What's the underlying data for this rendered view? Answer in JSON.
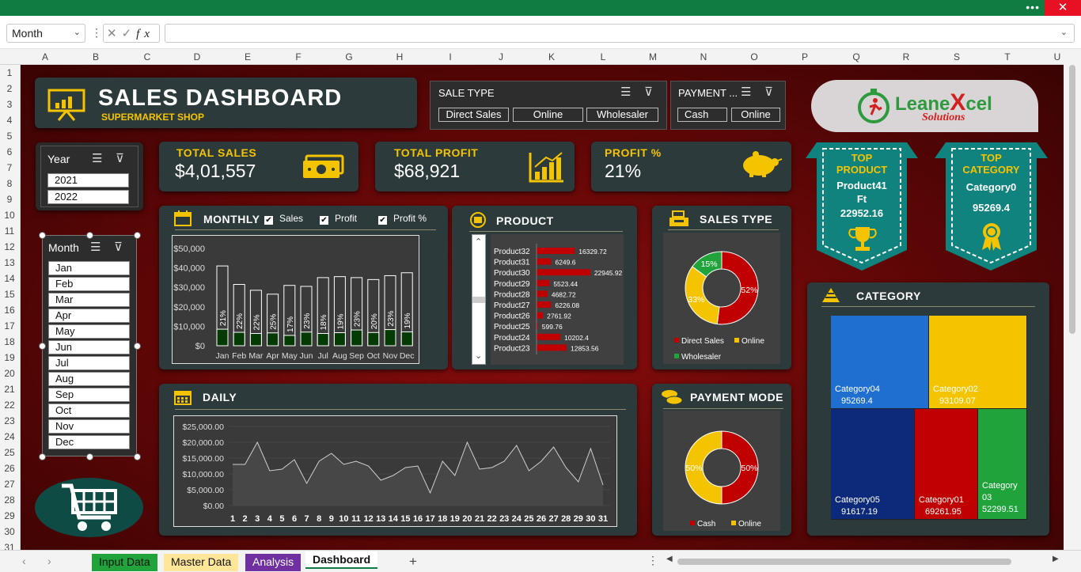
{
  "excel": {
    "name_box": "Month",
    "fx_label": "fx",
    "columns": [
      "A",
      "B",
      "C",
      "D",
      "E",
      "F",
      "G",
      "H",
      "I",
      "J",
      "K",
      "L",
      "M",
      "N",
      "O",
      "P",
      "Q",
      "R",
      "S",
      "T",
      "U"
    ],
    "rows": [
      "1",
      "2",
      "3",
      "4",
      "5",
      "6",
      "7",
      "8",
      "9",
      "10",
      "11",
      "12",
      "13",
      "14",
      "15",
      "16",
      "17",
      "18",
      "19",
      "20",
      "21",
      "22",
      "23",
      "24",
      "25",
      "26",
      "27",
      "28",
      "29",
      "30",
      "31"
    ],
    "sheet_tabs": [
      {
        "label": "Input Data",
        "color": "#21a33c"
      },
      {
        "label": "Master Data",
        "color": "#ffe699"
      },
      {
        "label": "Analysis",
        "color": "#7030a0"
      },
      {
        "label": "Dashboard",
        "color": "#ffffff"
      }
    ],
    "add_sheet": "+"
  },
  "header": {
    "title": "SALES DASHBOARD",
    "subtitle": "SUPERMARKET SHOP"
  },
  "logo": {
    "brand_a": "Leane",
    "brand_x": "X",
    "brand_b": "cel",
    "tagline": "Solutions"
  },
  "slicers": {
    "sale_type": {
      "title": "SALE TYPE",
      "items": [
        "Direct Sales",
        "Online",
        "Wholesaler"
      ]
    },
    "payment": {
      "title": "PAYMENT ...",
      "items": [
        "Cash",
        "Online"
      ]
    },
    "year": {
      "title": "Year",
      "items": [
        "2021",
        "2022"
      ]
    },
    "month": {
      "title": "Month",
      "items": [
        "Jan",
        "Feb",
        "Mar",
        "Apr",
        "May",
        "Jun",
        "Jul",
        "Aug",
        "Sep",
        "Oct",
        "Nov",
        "Dec"
      ]
    }
  },
  "kpis": {
    "total_sales": {
      "label": "TOTAL SALES",
      "value": "$4,01,557"
    },
    "total_profit": {
      "label": "TOTAL PROFIT",
      "value": "$68,921"
    },
    "profit_pct": {
      "label": "PROFIT %",
      "value": "21%"
    }
  },
  "top_product": {
    "title_a": "TOP",
    "title_b": "PRODUCT",
    "name_a": "Product41",
    "name_b": "Ft",
    "value": "22952.16"
  },
  "top_category": {
    "title_a": "TOP",
    "title_b": "CATEGORY",
    "name": "Category0",
    "value": "95269.4"
  },
  "monthly": {
    "title": "MONTHLY",
    "checks": [
      "Sales",
      "Profit",
      "Profit %"
    ]
  },
  "product_panel": {
    "title": "PRODUCT"
  },
  "sales_type_panel": {
    "title": "SALES TYPE"
  },
  "daily": {
    "title": "DAILY"
  },
  "payment_panel": {
    "title": "PAYMENT MODE"
  },
  "category_panel": {
    "title": "CATEGORY"
  },
  "chart_data": [
    {
      "type": "bar",
      "title": "MONTHLY",
      "categories": [
        "Jan",
        "Feb",
        "Mar",
        "Apr",
        "May",
        "Jun",
        "Jul",
        "Aug",
        "Sep",
        "Oct",
        "Nov",
        "Dec"
      ],
      "series": [
        {
          "name": "Sales",
          "values": [
            41000,
            31500,
            28500,
            26500,
            31000,
            30500,
            35000,
            35500,
            35000,
            34000,
            36000,
            37500
          ]
        },
        {
          "name": "Profit",
          "values": [
            8500,
            6900,
            6300,
            6600,
            5300,
            7000,
            6300,
            6700,
            8100,
            6800,
            8300,
            7100
          ]
        },
        {
          "name": "Profit %",
          "values": [
            "21%",
            "22%",
            "22%",
            "25%",
            "17%",
            "23%",
            "18%",
            "19%",
            "23%",
            "20%",
            "23%",
            "19%"
          ]
        }
      ],
      "ytick_labels": [
        "$50,000",
        "$40,000",
        "$30,000",
        "$20,000",
        "$10,000",
        "$0"
      ],
      "ylim": [
        0,
        50000
      ]
    },
    {
      "type": "bar",
      "title": "PRODUCT",
      "orientation": "horizontal",
      "categories": [
        "Product32",
        "Product31",
        "Product30",
        "Product29",
        "Product28",
        "Product27",
        "Product26",
        "Product25",
        "Product24",
        "Product23"
      ],
      "values": [
        16329.72,
        6249.6,
        22945.92,
        5523.44,
        4682.72,
        6226.08,
        2761.92,
        599.76,
        10202.4,
        12853.56
      ]
    },
    {
      "type": "pie",
      "title": "SALES TYPE",
      "labels": [
        "Direct Sales",
        "Online",
        "Wholesaler"
      ],
      "values": [
        52,
        33,
        15
      ],
      "value_labels": [
        "52%",
        "33%",
        "15%"
      ],
      "colors": [
        "#c00000",
        "#f5c400",
        "#21a33c"
      ]
    },
    {
      "type": "line",
      "title": "DAILY",
      "x": [
        1,
        2,
        3,
        4,
        5,
        6,
        7,
        8,
        9,
        10,
        11,
        12,
        13,
        14,
        15,
        16,
        17,
        18,
        19,
        20,
        21,
        22,
        23,
        24,
        25,
        26,
        27,
        28,
        29,
        30,
        31
      ],
      "y": [
        13000,
        13000,
        20000,
        11000,
        11500,
        14500,
        7000,
        14000,
        16500,
        13000,
        14000,
        12500,
        8000,
        9500,
        12000,
        12500,
        4000,
        14000,
        9500,
        20000,
        11500,
        12000,
        14000,
        19000,
        11000,
        14000,
        18500,
        12000,
        7500,
        18000,
        6500
      ],
      "ytick_labels": [
        "$25,000.00",
        "$20,000.00",
        "$15,000.00",
        "$10,000.00",
        "$5,000.00",
        "$0.00"
      ],
      "ylim": [
        0,
        25000
      ]
    },
    {
      "type": "pie",
      "title": "PAYMENT MODE",
      "labels": [
        "Cash",
        "Online"
      ],
      "values": [
        50,
        50
      ],
      "value_labels": [
        "50%",
        "50%"
      ],
      "colors": [
        "#c00000",
        "#f5c400"
      ]
    },
    {
      "type": "heatmap",
      "title": "CATEGORY",
      "labels": [
        "Category04",
        "Category02",
        "Category05",
        "Category01",
        "Category03"
      ],
      "values": [
        95269.4,
        93109.07,
        91617.19,
        69261.95,
        52299.51
      ],
      "value_labels": [
        "95269.4",
        "93109.07",
        "91617.19",
        "69261.95",
        "52299.51"
      ],
      "colors": [
        "#1f6fd1",
        "#f5c400",
        "#0d2a7a",
        "#c00000",
        "#21a33c"
      ]
    }
  ]
}
